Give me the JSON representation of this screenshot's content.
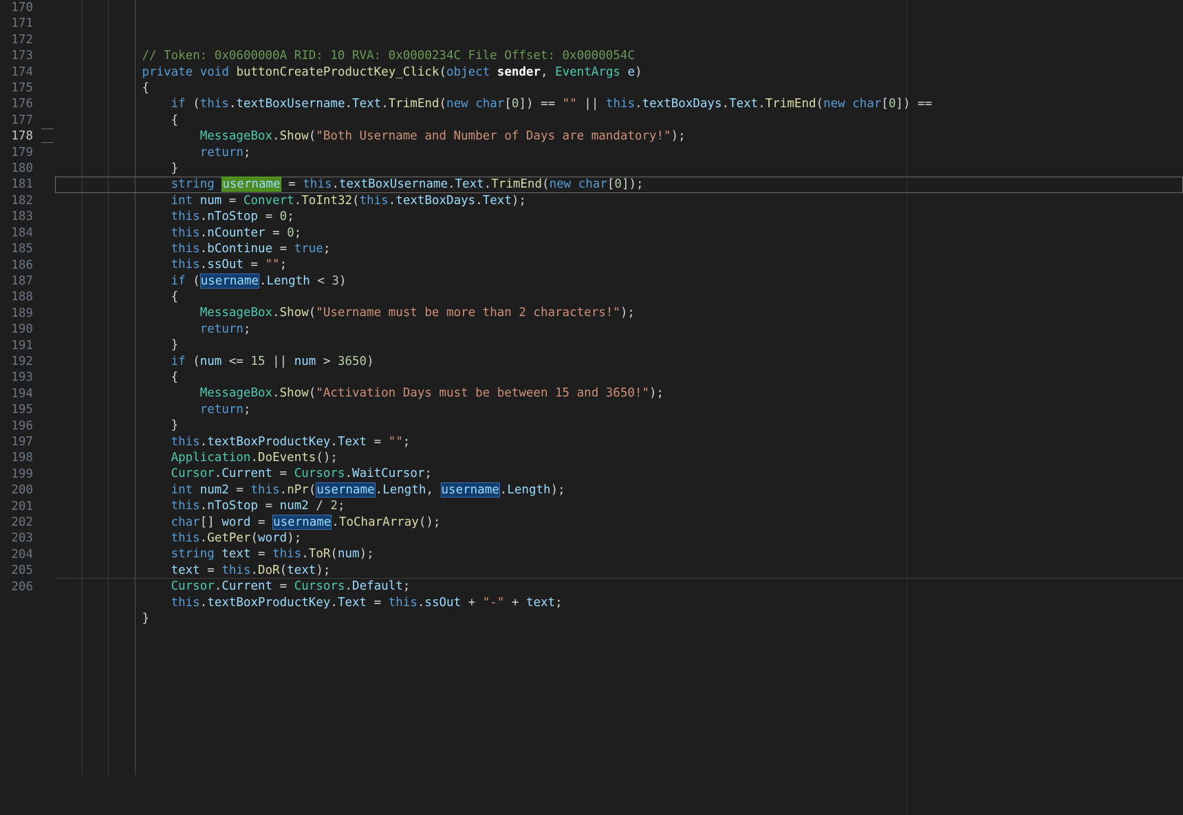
{
  "editor": {
    "first_line": 170,
    "current_line": 178
  },
  "lines": {
    "170": {
      "indent": 3,
      "tokens": [
        [
          "cm",
          "// Token: 0x0600000A RID: 10 RVA: 0x0000234C File Offset: 0x0000054C"
        ]
      ]
    },
    "171": {
      "indent": 3,
      "tokens": [
        [
          "kw",
          "private"
        ],
        [
          "pu",
          " "
        ],
        [
          "kw",
          "void"
        ],
        [
          "pu",
          " "
        ],
        [
          "mt",
          "buttonCreateProductKey_Click"
        ],
        [
          "pu",
          "("
        ],
        [
          "kw",
          "object"
        ],
        [
          "pu",
          " "
        ],
        [
          "wh",
          "sender"
        ],
        [
          "pu",
          ", "
        ],
        [
          "ty",
          "EventArgs"
        ],
        [
          "pu",
          " "
        ],
        [
          "id",
          "e"
        ],
        [
          "pu",
          ")"
        ]
      ]
    },
    "172": {
      "indent": 3,
      "tokens": [
        [
          "pu",
          "{"
        ]
      ]
    },
    "173": {
      "indent": 4,
      "tokens": [
        [
          "kw",
          "if"
        ],
        [
          "pu",
          " ("
        ],
        [
          "kw",
          "this"
        ],
        [
          "pu",
          "."
        ],
        [
          "id",
          "textBoxUsername"
        ],
        [
          "pu",
          "."
        ],
        [
          "id",
          "Text"
        ],
        [
          "pu",
          "."
        ],
        [
          "mt",
          "TrimEnd"
        ],
        [
          "pu",
          "("
        ],
        [
          "kw",
          "new"
        ],
        [
          "pu",
          " "
        ],
        [
          "kw",
          "char"
        ],
        [
          "pu",
          "["
        ],
        [
          "nu",
          "0"
        ],
        [
          "pu",
          "]) == "
        ],
        [
          "st",
          "\"\""
        ],
        [
          "pu",
          " || "
        ],
        [
          "kw",
          "this"
        ],
        [
          "pu",
          "."
        ],
        [
          "id",
          "textBoxDays"
        ],
        [
          "pu",
          "."
        ],
        [
          "id",
          "Text"
        ],
        [
          "pu",
          "."
        ],
        [
          "mt",
          "TrimEnd"
        ],
        [
          "pu",
          "("
        ],
        [
          "kw",
          "new"
        ],
        [
          "pu",
          " "
        ],
        [
          "kw",
          "char"
        ],
        [
          "pu",
          "["
        ],
        [
          "nu",
          "0"
        ],
        [
          "pu",
          "]) =="
        ]
      ]
    },
    "174": {
      "indent": 4,
      "tokens": [
        [
          "pu",
          "{"
        ]
      ]
    },
    "175": {
      "indent": 5,
      "tokens": [
        [
          "ty",
          "MessageBox"
        ],
        [
          "pu",
          "."
        ],
        [
          "mt",
          "Show"
        ],
        [
          "pu",
          "("
        ],
        [
          "st",
          "\"Both Username and Number of Days are mandatory!\""
        ],
        [
          "pu",
          ");"
        ]
      ]
    },
    "176": {
      "indent": 5,
      "tokens": [
        [
          "kw",
          "return"
        ],
        [
          "pu",
          ";"
        ]
      ]
    },
    "177": {
      "indent": 4,
      "tokens": [
        [
          "pu",
          "}"
        ]
      ]
    },
    "178": {
      "indent": 4,
      "tokens": [
        [
          "kw",
          "string"
        ],
        [
          "pu",
          " "
        ],
        [
          "hp id",
          "username"
        ],
        [
          "pu",
          " = "
        ],
        [
          "kw",
          "this"
        ],
        [
          "pu",
          "."
        ],
        [
          "id",
          "textBoxUsername"
        ],
        [
          "pu",
          "."
        ],
        [
          "id",
          "Text"
        ],
        [
          "pu",
          "."
        ],
        [
          "mt",
          "TrimEnd"
        ],
        [
          "pu",
          "("
        ],
        [
          "kw",
          "new"
        ],
        [
          "pu",
          " "
        ],
        [
          "kw",
          "char"
        ],
        [
          "pu",
          "["
        ],
        [
          "nu",
          "0"
        ],
        [
          "pu",
          "]);"
        ]
      ]
    },
    "179": {
      "indent": 4,
      "tokens": [
        [
          "kw",
          "int"
        ],
        [
          "pu",
          " "
        ],
        [
          "id",
          "num"
        ],
        [
          "pu",
          " = "
        ],
        [
          "ty",
          "Convert"
        ],
        [
          "pu",
          "."
        ],
        [
          "mt",
          "ToInt32"
        ],
        [
          "pu",
          "("
        ],
        [
          "kw",
          "this"
        ],
        [
          "pu",
          "."
        ],
        [
          "id",
          "textBoxDays"
        ],
        [
          "pu",
          "."
        ],
        [
          "id",
          "Text"
        ],
        [
          "pu",
          ");"
        ]
      ]
    },
    "180": {
      "indent": 4,
      "tokens": [
        [
          "kw",
          "this"
        ],
        [
          "pu",
          "."
        ],
        [
          "id",
          "nToStop"
        ],
        [
          "pu",
          " = "
        ],
        [
          "nu",
          "0"
        ],
        [
          "pu",
          ";"
        ]
      ]
    },
    "181": {
      "indent": 4,
      "tokens": [
        [
          "kw",
          "this"
        ],
        [
          "pu",
          "."
        ],
        [
          "id",
          "nCounter"
        ],
        [
          "pu",
          " = "
        ],
        [
          "nu",
          "0"
        ],
        [
          "pu",
          ";"
        ]
      ]
    },
    "182": {
      "indent": 4,
      "tokens": [
        [
          "kw",
          "this"
        ],
        [
          "pu",
          "."
        ],
        [
          "id",
          "bContinue"
        ],
        [
          "pu",
          " = "
        ],
        [
          "kw",
          "true"
        ],
        [
          "pu",
          ";"
        ]
      ]
    },
    "183": {
      "indent": 4,
      "tokens": [
        [
          "kw",
          "this"
        ],
        [
          "pu",
          "."
        ],
        [
          "id",
          "ssOut"
        ],
        [
          "pu",
          " = "
        ],
        [
          "st",
          "\"\""
        ],
        [
          "pu",
          ";"
        ]
      ]
    },
    "184": {
      "indent": 4,
      "tokens": [
        [
          "kw",
          "if"
        ],
        [
          "pu",
          " ("
        ],
        [
          "hl id",
          "username"
        ],
        [
          "pu",
          "."
        ],
        [
          "id",
          "Length"
        ],
        [
          "pu",
          " < "
        ],
        [
          "nu",
          "3"
        ],
        [
          "pu",
          ")"
        ]
      ]
    },
    "185": {
      "indent": 4,
      "tokens": [
        [
          "pu",
          "{"
        ]
      ]
    },
    "186": {
      "indent": 5,
      "tokens": [
        [
          "ty",
          "MessageBox"
        ],
        [
          "pu",
          "."
        ],
        [
          "mt",
          "Show"
        ],
        [
          "pu",
          "("
        ],
        [
          "st",
          "\"Username must be more than 2 characters!\""
        ],
        [
          "pu",
          ");"
        ]
      ]
    },
    "187": {
      "indent": 5,
      "tokens": [
        [
          "kw",
          "return"
        ],
        [
          "pu",
          ";"
        ]
      ]
    },
    "188": {
      "indent": 4,
      "tokens": [
        [
          "pu",
          "}"
        ]
      ]
    },
    "189": {
      "indent": 4,
      "tokens": [
        [
          "kw",
          "if"
        ],
        [
          "pu",
          " ("
        ],
        [
          "id",
          "num"
        ],
        [
          "pu",
          " <= "
        ],
        [
          "nu",
          "15"
        ],
        [
          "pu",
          " || "
        ],
        [
          "id",
          "num"
        ],
        [
          "pu",
          " > "
        ],
        [
          "nu",
          "3650"
        ],
        [
          "pu",
          ")"
        ]
      ]
    },
    "190": {
      "indent": 4,
      "tokens": [
        [
          "pu",
          "{"
        ]
      ]
    },
    "191": {
      "indent": 5,
      "tokens": [
        [
          "ty",
          "MessageBox"
        ],
        [
          "pu",
          "."
        ],
        [
          "mt",
          "Show"
        ],
        [
          "pu",
          "("
        ],
        [
          "st",
          "\"Activation Days must be between 15 and 3650!\""
        ],
        [
          "pu",
          ");"
        ]
      ]
    },
    "192": {
      "indent": 5,
      "tokens": [
        [
          "kw",
          "return"
        ],
        [
          "pu",
          ";"
        ]
      ]
    },
    "193": {
      "indent": 4,
      "tokens": [
        [
          "pu",
          "}"
        ]
      ]
    },
    "194": {
      "indent": 4,
      "tokens": [
        [
          "kw",
          "this"
        ],
        [
          "pu",
          "."
        ],
        [
          "id",
          "textBoxProductKey"
        ],
        [
          "pu",
          "."
        ],
        [
          "id",
          "Text"
        ],
        [
          "pu",
          " = "
        ],
        [
          "st",
          "\"\""
        ],
        [
          "pu",
          ";"
        ]
      ]
    },
    "195": {
      "indent": 4,
      "tokens": [
        [
          "ty",
          "Application"
        ],
        [
          "pu",
          "."
        ],
        [
          "mt",
          "DoEvents"
        ],
        [
          "pu",
          "();"
        ]
      ]
    },
    "196": {
      "indent": 4,
      "tokens": [
        [
          "ty",
          "Cursor"
        ],
        [
          "pu",
          "."
        ],
        [
          "id",
          "Current"
        ],
        [
          "pu",
          " = "
        ],
        [
          "ty",
          "Cursors"
        ],
        [
          "pu",
          "."
        ],
        [
          "id",
          "WaitCursor"
        ],
        [
          "pu",
          ";"
        ]
      ]
    },
    "197": {
      "indent": 4,
      "tokens": [
        [
          "kw",
          "int"
        ],
        [
          "pu",
          " "
        ],
        [
          "id",
          "num2"
        ],
        [
          "pu",
          " = "
        ],
        [
          "kw",
          "this"
        ],
        [
          "pu",
          "."
        ],
        [
          "mt",
          "nPr"
        ],
        [
          "pu",
          "("
        ],
        [
          "hl id",
          "username"
        ],
        [
          "pu",
          "."
        ],
        [
          "id",
          "Length"
        ],
        [
          "pu",
          ", "
        ],
        [
          "hl id",
          "username"
        ],
        [
          "pu",
          "."
        ],
        [
          "id",
          "Length"
        ],
        [
          "pu",
          ");"
        ]
      ]
    },
    "198": {
      "indent": 4,
      "tokens": [
        [
          "kw",
          "this"
        ],
        [
          "pu",
          "."
        ],
        [
          "id",
          "nToStop"
        ],
        [
          "pu",
          " = "
        ],
        [
          "id",
          "num2"
        ],
        [
          "pu",
          " / "
        ],
        [
          "nu",
          "2"
        ],
        [
          "pu",
          ";"
        ]
      ]
    },
    "199": {
      "indent": 4,
      "tokens": [
        [
          "kw",
          "char"
        ],
        [
          "pu",
          "[] "
        ],
        [
          "id",
          "word"
        ],
        [
          "pu",
          " = "
        ],
        [
          "hl id",
          "username"
        ],
        [
          "pu",
          "."
        ],
        [
          "mt",
          "ToCharArray"
        ],
        [
          "pu",
          "();"
        ]
      ]
    },
    "200": {
      "indent": 4,
      "tokens": [
        [
          "kw",
          "this"
        ],
        [
          "pu",
          "."
        ],
        [
          "mt",
          "GetPer"
        ],
        [
          "pu",
          "("
        ],
        [
          "id",
          "word"
        ],
        [
          "pu",
          ");"
        ]
      ]
    },
    "201": {
      "indent": 4,
      "tokens": [
        [
          "kw",
          "string"
        ],
        [
          "pu",
          " "
        ],
        [
          "id",
          "text"
        ],
        [
          "pu",
          " = "
        ],
        [
          "kw",
          "this"
        ],
        [
          "pu",
          "."
        ],
        [
          "mt",
          "ToR"
        ],
        [
          "pu",
          "("
        ],
        [
          "id",
          "num"
        ],
        [
          "pu",
          ");"
        ]
      ]
    },
    "202": {
      "indent": 4,
      "tokens": [
        [
          "id",
          "text"
        ],
        [
          "pu",
          " = "
        ],
        [
          "kw",
          "this"
        ],
        [
          "pu",
          "."
        ],
        [
          "mt",
          "DoR"
        ],
        [
          "pu",
          "("
        ],
        [
          "id",
          "text"
        ],
        [
          "pu",
          ");"
        ]
      ]
    },
    "203": {
      "indent": 4,
      "tokens": [
        [
          "ty",
          "Cursor"
        ],
        [
          "pu",
          "."
        ],
        [
          "id",
          "Current"
        ],
        [
          "pu",
          " = "
        ],
        [
          "ty",
          "Cursors"
        ],
        [
          "pu",
          "."
        ],
        [
          "id",
          "Default"
        ],
        [
          "pu",
          ";"
        ]
      ]
    },
    "204": {
      "indent": 4,
      "tokens": [
        [
          "kw",
          "this"
        ],
        [
          "pu",
          "."
        ],
        [
          "id",
          "textBoxProductKey"
        ],
        [
          "pu",
          "."
        ],
        [
          "id",
          "Text"
        ],
        [
          "pu",
          " = "
        ],
        [
          "kw",
          "this"
        ],
        [
          "pu",
          "."
        ],
        [
          "id",
          "ssOut"
        ],
        [
          "pu",
          " + "
        ],
        [
          "st",
          "\"-\""
        ],
        [
          "pu",
          " + "
        ],
        [
          "id",
          "text"
        ],
        [
          "pu",
          ";"
        ]
      ]
    },
    "205": {
      "indent": 3,
      "tokens": [
        [
          "pu",
          "}"
        ]
      ]
    },
    "206": {
      "indent": 0,
      "tokens": []
    }
  }
}
